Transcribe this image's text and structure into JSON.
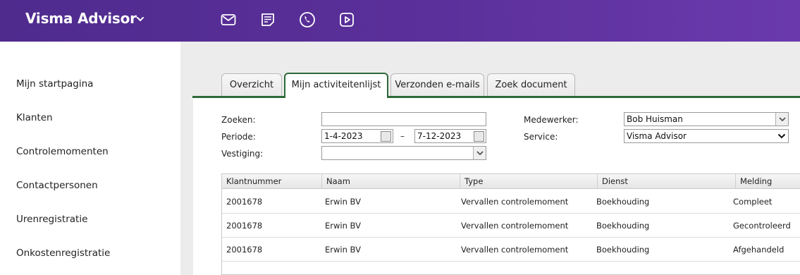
{
  "header": {
    "brand": "Visma Advisor",
    "icons": [
      "mail-icon",
      "notes-icon",
      "phone-icon",
      "video-icon"
    ]
  },
  "sidebar": {
    "items": [
      {
        "label": "Mijn startpagina"
      },
      {
        "label": "Klanten"
      },
      {
        "label": "Controlemomenten"
      },
      {
        "label": "Contactpersonen"
      },
      {
        "label": "Urenregistratie"
      },
      {
        "label": "Onkostenregistratie"
      }
    ]
  },
  "tabs": [
    {
      "label": "Overzicht"
    },
    {
      "label": "Mijn activiteitenlijst"
    },
    {
      "label": "Verzonden e-mails"
    },
    {
      "label": "Zoek document"
    }
  ],
  "filters": {
    "zoeken_label": "Zoeken:",
    "zoeken_value": "",
    "periode_label": "Periode:",
    "periode_from": "1-4-2023",
    "periode_separator": "–",
    "periode_to": "7-12-2023",
    "vestiging_label": "Vestiging:",
    "vestiging_value": "",
    "medewerker_label": "Medewerker:",
    "medewerker_value": "Bob Huisman",
    "service_label": "Service:",
    "service_value": "Visma Advisor"
  },
  "table": {
    "columns": [
      "Klantnummer",
      "Naam",
      "Type",
      "Dienst",
      "Melding"
    ],
    "rows": [
      [
        "2001678",
        "Erwin BV",
        "Vervallen controlemoment",
        "Boekhouding",
        "Compleet"
      ],
      [
        "2001678",
        "Erwin BV",
        "Vervallen controlemoment",
        "Boekhouding",
        "Gecontroleerd"
      ],
      [
        "2001678",
        "Erwin BV",
        "Vervallen controlemoment",
        "Boekhouding",
        "Afgehandeld"
      ]
    ]
  },
  "colors": {
    "header_start": "#4f2b8e",
    "header_end": "#6a3aad",
    "tab_accent": "#2d6a3a"
  }
}
